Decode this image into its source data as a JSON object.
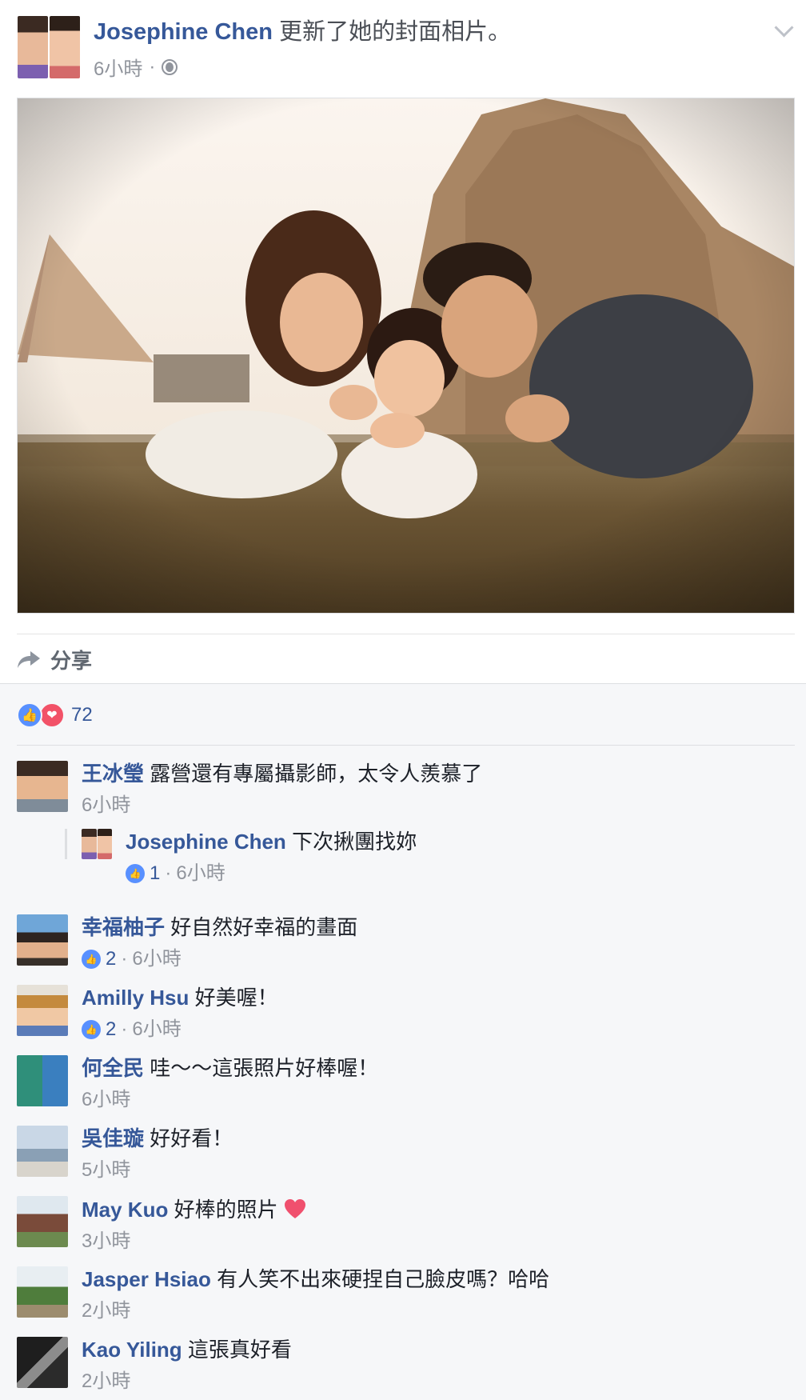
{
  "post": {
    "author": "Josephine Chen",
    "action": "更新了她的封面相片。",
    "time": "6小時",
    "separator": "·",
    "audience_icon": "globe-icon",
    "menu_icon": "chevron-down-icon"
  },
  "actions": {
    "share_label": "分享",
    "share_icon": "share-arrow-icon"
  },
  "reactions": {
    "count": "72",
    "types": [
      "like",
      "love"
    ],
    "like_color": "#5890ff",
    "love_color": "#f25268"
  },
  "comments": [
    {
      "name": "王冰瑩",
      "text": "露營還有專屬攝影師，太令人羨慕了",
      "likes": "",
      "time": "6小時",
      "reply": {
        "name": "Josephine Chen",
        "text": "下次揪團找妳",
        "likes": "1",
        "separator": "·",
        "time": "6小時"
      }
    },
    {
      "name": "幸福柚子",
      "text": "好自然好幸福的畫面",
      "likes": "2",
      "separator": "·",
      "time": "6小時"
    },
    {
      "name": "Amilly Hsu",
      "text": "好美喔！",
      "likes": "2",
      "separator": "·",
      "time": "6小時"
    },
    {
      "name": "何全民",
      "text": "哇～～這張照片好棒喔！",
      "likes": "",
      "time": "6小時"
    },
    {
      "name": "吳佳璇",
      "text": "好好看！",
      "likes": "",
      "time": "5小時"
    },
    {
      "name": "May Kuo",
      "text": "好棒的照片",
      "emoji": "heart-icon",
      "likes": "",
      "time": "3小時"
    },
    {
      "name": "Jasper Hsiao",
      "text": "有人笑不出來硬捏自己臉皮嗎？哈哈",
      "likes": "",
      "time": "2小時"
    },
    {
      "name": "Kao Yiling",
      "text": "這張真好看",
      "likes": "",
      "time": "2小時"
    }
  ],
  "colors": {
    "link": "#365899",
    "meta": "#90949c",
    "text": "#1d2129",
    "comment_bg": "#f6f7f9"
  }
}
